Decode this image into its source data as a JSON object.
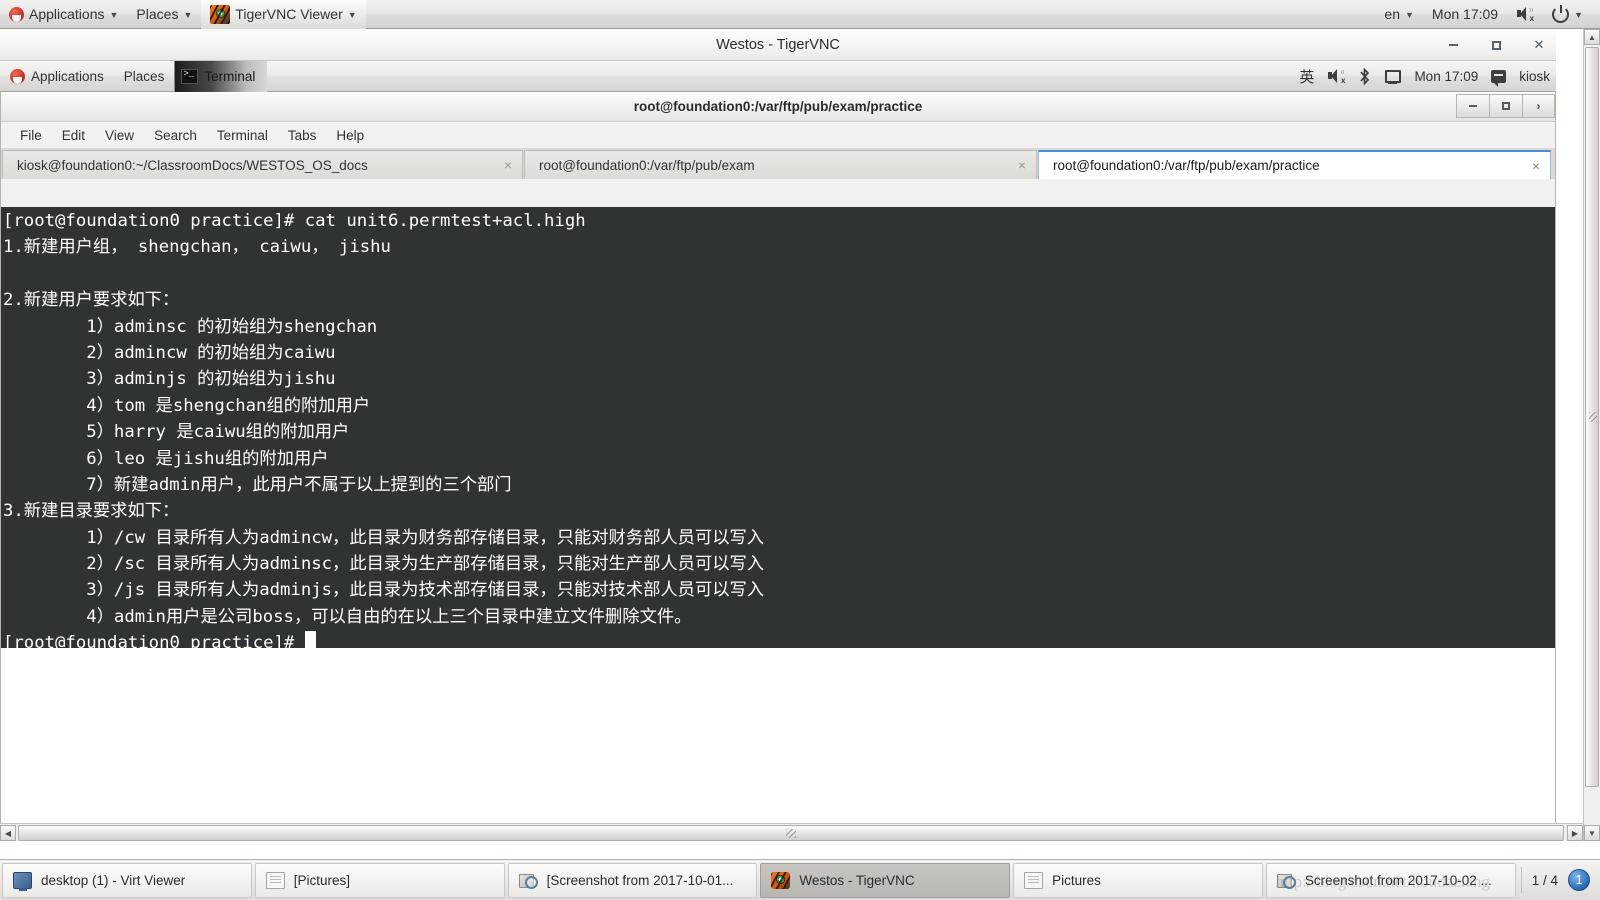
{
  "outer_panel": {
    "applications": "Applications",
    "places": "Places",
    "app_window": "TigerVNC Viewer",
    "keyboard_layout": "en",
    "clock": "Mon 17:09",
    "icons": [
      "fedora-logo",
      "tigervnc-icon",
      "volume-muted-icon",
      "power-icon"
    ]
  },
  "vnc_window": {
    "title": "Westos - TigerVNC",
    "buttons": {
      "minimize": "_",
      "maximize": "□",
      "close": "✕"
    }
  },
  "inner_panel": {
    "applications": "Applications",
    "places": "Places",
    "active_app": "Terminal",
    "ime": "英",
    "clock": "Mon 17:09",
    "user": "kiosk"
  },
  "terminal_window": {
    "title": "root@foundation0:/var/ftp/pub/exam/practice",
    "menu": [
      "File",
      "Edit",
      "View",
      "Search",
      "Terminal",
      "Tabs",
      "Help"
    ],
    "window_buttons": {
      "minimize": "_",
      "maximize": "□",
      "close": "›"
    },
    "tabs": [
      {
        "label": "kiosk@foundation0:~/ClassroomDocs/WESTOS_OS_docs",
        "active": false,
        "close": "×"
      },
      {
        "label": "root@foundation0:/var/ftp/pub/exam",
        "active": false,
        "close": "×"
      },
      {
        "label": "root@foundation0:/var/ftp/pub/exam/practice",
        "active": true,
        "close": "×"
      }
    ],
    "screen_lines": [
      "[root@foundation0 practice]# cat unit6.permtest+acl.high",
      "1.新建用户组， shengchan， caiwu， jishu",
      "",
      "2.新建用户要求如下：",
      "        1）adminsc 的初始组为shengchan",
      "        2）admincw 的初始组为caiwu",
      "        3）adminjs 的初始组为jishu",
      "        4）tom 是shengchan组的附加用户",
      "        5）harry 是caiwu组的附加用户",
      "        6）leo 是jishu组的附加用户",
      "        7）新建admin用户，此用户不属于以上提到的三个部门",
      "3.新建目录要求如下：",
      "        1）/cw 目录所有人为admincw，此目录为财务部存储目录，只能对财务部人员可以写入",
      "        2）/sc 目录所有人为adminsc，此目录为生产部存储目录，只能对生产部人员可以写入",
      "        3）/js 目录所有人为adminjs，此目录为技术部存储目录，只能对技术部人员可以写入",
      "        4）admin用户是公司boss，可以自由的在以上三个目录中建立文件删除文件。"
    ],
    "prompt": "[root@foundation0 practice]# ",
    "colors": {
      "background": "#2e3436",
      "foreground": "#ffffff"
    }
  },
  "taskbar": {
    "tasks": [
      {
        "label": "desktop (1) - Virt Viewer",
        "icon": "monitor-icon",
        "active": false
      },
      {
        "label": "[Pictures]",
        "icon": "document-icon",
        "active": false
      },
      {
        "label": "[Screenshot from 2017-10-01...",
        "icon": "screenshot-icon",
        "active": false
      },
      {
        "label": "Westos - TigerVNC",
        "icon": "tigervnc-icon",
        "active": true
      },
      {
        "label": "Pictures",
        "icon": "document-icon",
        "active": false
      },
      {
        "label": "Screenshot from 2017-10-02 ...",
        "icon": "screenshot-icon",
        "active": false
      }
    ],
    "pager": "1 / 4",
    "workspace": "1",
    "watermark": "http://blog.csdn.net/houdaziang"
  }
}
